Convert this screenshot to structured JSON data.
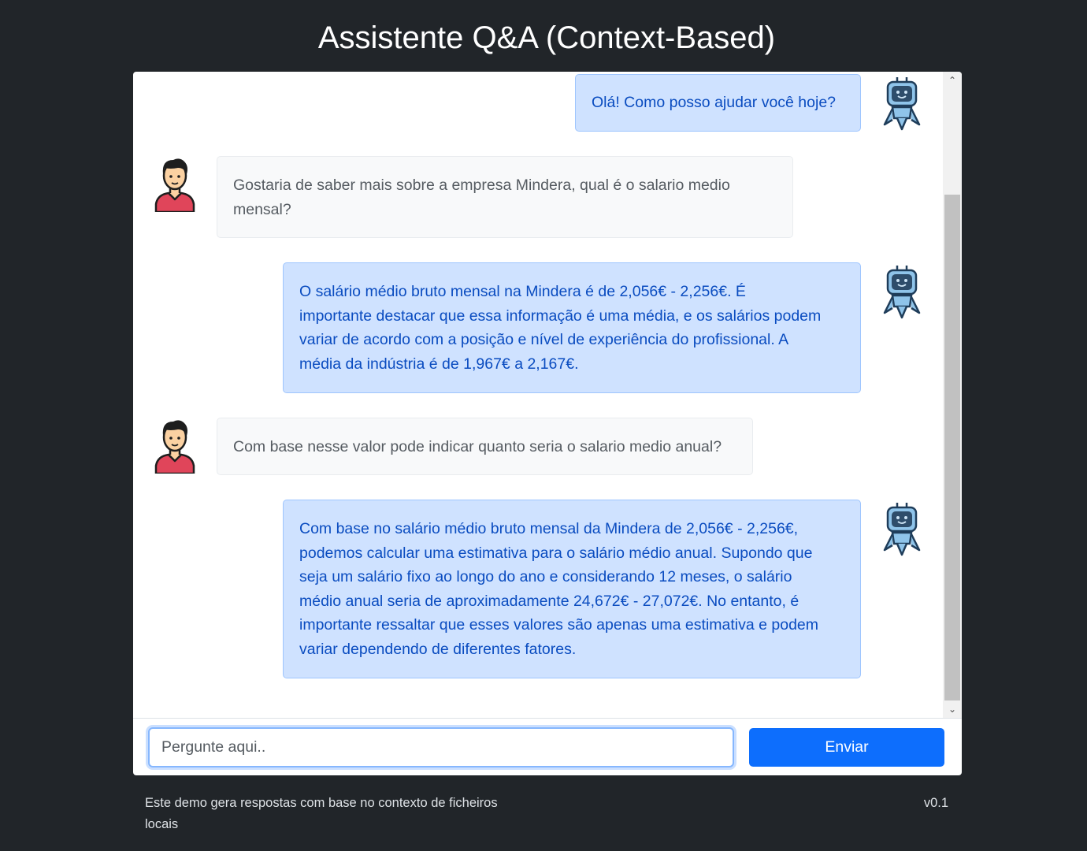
{
  "title": "Assistente Q&A (Context-Based)",
  "messages": [
    {
      "role": "bot",
      "lines": [
        "Olá! Como posso ajudar você hoje?"
      ]
    },
    {
      "role": "user",
      "lines": [
        "Gostaria de saber mais sobre a empresa Mindera, qual é o salario medio",
        "mensal?"
      ]
    },
    {
      "role": "bot",
      "lines": [
        "O salário médio bruto mensal na Mindera é de 2,056€ - 2,256€. É",
        "importante destacar que essa informação é uma média, e os salários podem",
        "variar de acordo com a posição e nível de experiência do profissional. A",
        "média da indústria é de 1,967€ a 2,167€."
      ]
    },
    {
      "role": "user",
      "lines": [
        "Com base nesse valor pode indicar quanto seria o salario medio anual?"
      ]
    },
    {
      "role": "bot",
      "lines": [
        "Com base no salário médio bruto mensal da Mindera de 2,056€ - 2,256€,",
        "podemos calcular uma estimativa para o salário médio anual. Supondo que",
        "seja um salário fixo ao longo do ano e considerando 12 meses, o salário",
        "médio anual seria de aproximadamente 24,672€ - 27,072€. No entanto, é",
        "importante ressaltar que esses valores são apenas uma estimativa e podem",
        "variar dependendo de diferentes fatores."
      ]
    }
  ],
  "input": {
    "placeholder": "Pergunte aqui.."
  },
  "send_label": "Enviar",
  "footer": {
    "note_lines": [
      "Este demo gera respostas com base no contexto de ficheiros",
      "locais"
    ],
    "version": "v0.1"
  },
  "colors": {
    "background": "#212529",
    "bot_bubble": "#cfe2ff",
    "bot_text": "#0a4cc0",
    "user_bubble": "#f8f9fa",
    "send_button": "#0d6efd"
  }
}
